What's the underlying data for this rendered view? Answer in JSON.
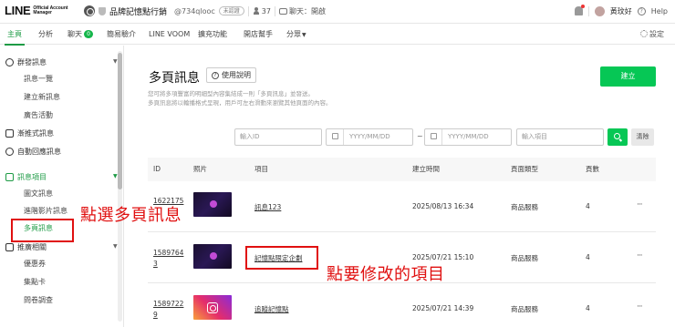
{
  "logo": {
    "main": "LINE",
    "sub1": "Official Account",
    "sub2": "Manager"
  },
  "account": {
    "name": "品牌記憶點行銷",
    "id": "@734qlooc",
    "plan": "未認證",
    "friends": "37",
    "chat_status": "聊天：開啟"
  },
  "user": {
    "name": "黃玟好",
    "help": "Help"
  },
  "nav": {
    "items": [
      "主頁",
      "分析",
      "聊天",
      "簡易驗介",
      "LINE VOOM",
      "擴充功能",
      "開店幫手",
      "分眾"
    ],
    "chat_badge": "0",
    "settings": "設定"
  },
  "sidebar": {
    "group_broadcast": "群發訊息",
    "broadcast_items": [
      "訊息一覽",
      "建立新訊息",
      "廣告活動"
    ],
    "step": "漸推式訊息",
    "auto": "自動回應訊息",
    "group_message": "訊息項目",
    "message_items": [
      "圖文訊息",
      "進階影片訊息",
      "多頁訊息"
    ],
    "group_promo": "推廣相關",
    "promo_items": [
      "優惠券",
      "集點卡",
      "問卷調查"
    ]
  },
  "main": {
    "title": "多頁訊息",
    "help_button": "使用說明",
    "create_button": "建立",
    "desc1": "您可將多項豐富的明細型內容集結成一則「多頁訊息」並發送。",
    "desc2": "多頁訊息將以輪播格式呈現，用戶可左右滑動來瀏覽其他頁面的內容。",
    "filter": {
      "id_placeholder": "輸入ID",
      "date_from_placeholder": "YYYY/MM/DD",
      "date_to_placeholder": "YYYY/MM/DD",
      "range_sep": "~",
      "name_placeholder": "輸入項目",
      "clear": "清除"
    },
    "columns": [
      "ID",
      "照片",
      "項目",
      "建立時間",
      "頁面類型",
      "頁數"
    ],
    "rows": [
      {
        "id": "1622175",
        "id2": "",
        "name": "訊息123",
        "created": "2025/08/13 16:34",
        "type": "商品服務",
        "pages": "4",
        "more": "···"
      },
      {
        "id": "1589764",
        "id2": "3",
        "name": "記憶點限定企劃",
        "created": "2025/07/21 15:10",
        "type": "商品服務",
        "pages": "4",
        "more": "···"
      },
      {
        "id": "1589722",
        "id2": "9",
        "name": "追蹤記憶點",
        "created": "2025/07/21 14:39",
        "type": "商品服務",
        "pages": "4",
        "more": "···"
      }
    ]
  },
  "annotations": {
    "select_text": "點選多頁訊息",
    "edit_text": "點要修改的項目"
  },
  "colors": {
    "accent": "#06c755",
    "nav_active": "#1d9b45",
    "annotation": "#e01010"
  }
}
